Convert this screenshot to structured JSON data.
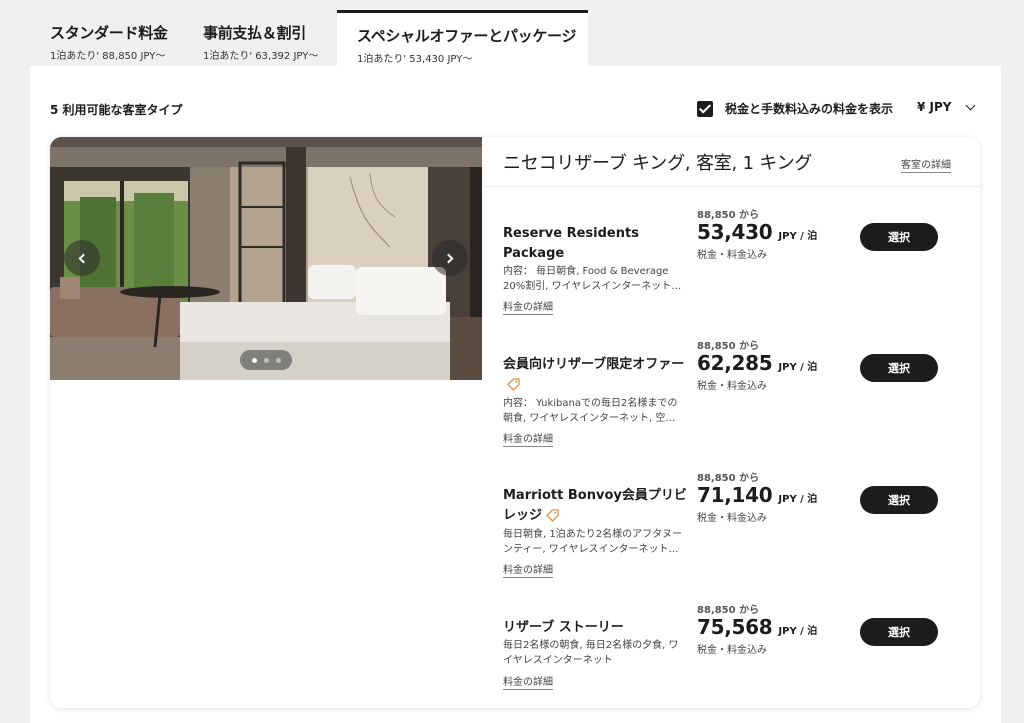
{
  "tabs": [
    {
      "title": "スタンダード料金",
      "subtitle": "1泊あたり' 88,850 JPY〜"
    },
    {
      "title": "事前支払＆割引",
      "subtitle": "1泊あたり' 63,392 JPY〜"
    },
    {
      "title": "スペシャルオファーとパッケージ",
      "subtitle": "1泊あたり' 53,430 JPY〜",
      "active": true
    }
  ],
  "filters": {
    "room_count": "5 利用可能な客室タイプ",
    "tax_label": "税金と手数料込みの料金を表示",
    "currency": "¥ JPY"
  },
  "room": {
    "name": "ニセコリザーブ キング, 客室, 1 キング",
    "detail_link": "客室の詳細",
    "photo_icon": "bedroom-photo",
    "carousel_total": 3,
    "carousel_active": 1
  },
  "rates": [
    {
      "name": "Reserve Residents Package",
      "tag_icon": false,
      "description": "内容： 毎日朝食, Food & Beverage 20%割引, ワイヤレスインターネット…",
      "detail_link": "料金の詳細",
      "from_label": "88,850 から",
      "price": "53,430",
      "unit": "JPY / 泊",
      "note": "税金・料金込み",
      "button": "選択"
    },
    {
      "name": "会員向けリザーブ限定オファー",
      "tag_icon": true,
      "description": "内容： Yukibanaでの毎日2名様までの朝食, ワイヤレスインターネット, 空…",
      "detail_link": "料金の詳細",
      "from_label": "88,850 から",
      "price": "62,285",
      "unit": "JPY / 泊",
      "note": "税金・料金込み",
      "button": "選択"
    },
    {
      "name": "Marriott Bonvoy会員プリビレッジ",
      "tag_icon": true,
      "description": "毎日朝食, 1泊あたり2名様のアフタヌーンティー, ワイヤレスインターネット…",
      "detail_link": "料金の詳細",
      "from_label": "88,850 から",
      "price": "71,140",
      "unit": "JPY / 泊",
      "note": "税金・料金込み",
      "button": "選択"
    },
    {
      "name": "リザーブ ストーリー",
      "tag_icon": false,
      "description": "毎日2名様の朝食, 毎日2名様の夕食, ワイヤレスインターネット",
      "detail_link": "料金の詳細",
      "from_label": "88,850 から",
      "price": "75,568",
      "unit": "JPY / 泊",
      "note": "税金・料金込み",
      "button": "選択"
    }
  ],
  "colors": {
    "accent_dark": "#1c1c1c",
    "tag_orange": "#e8903f",
    "page_bg": "#f0f0f0"
  }
}
